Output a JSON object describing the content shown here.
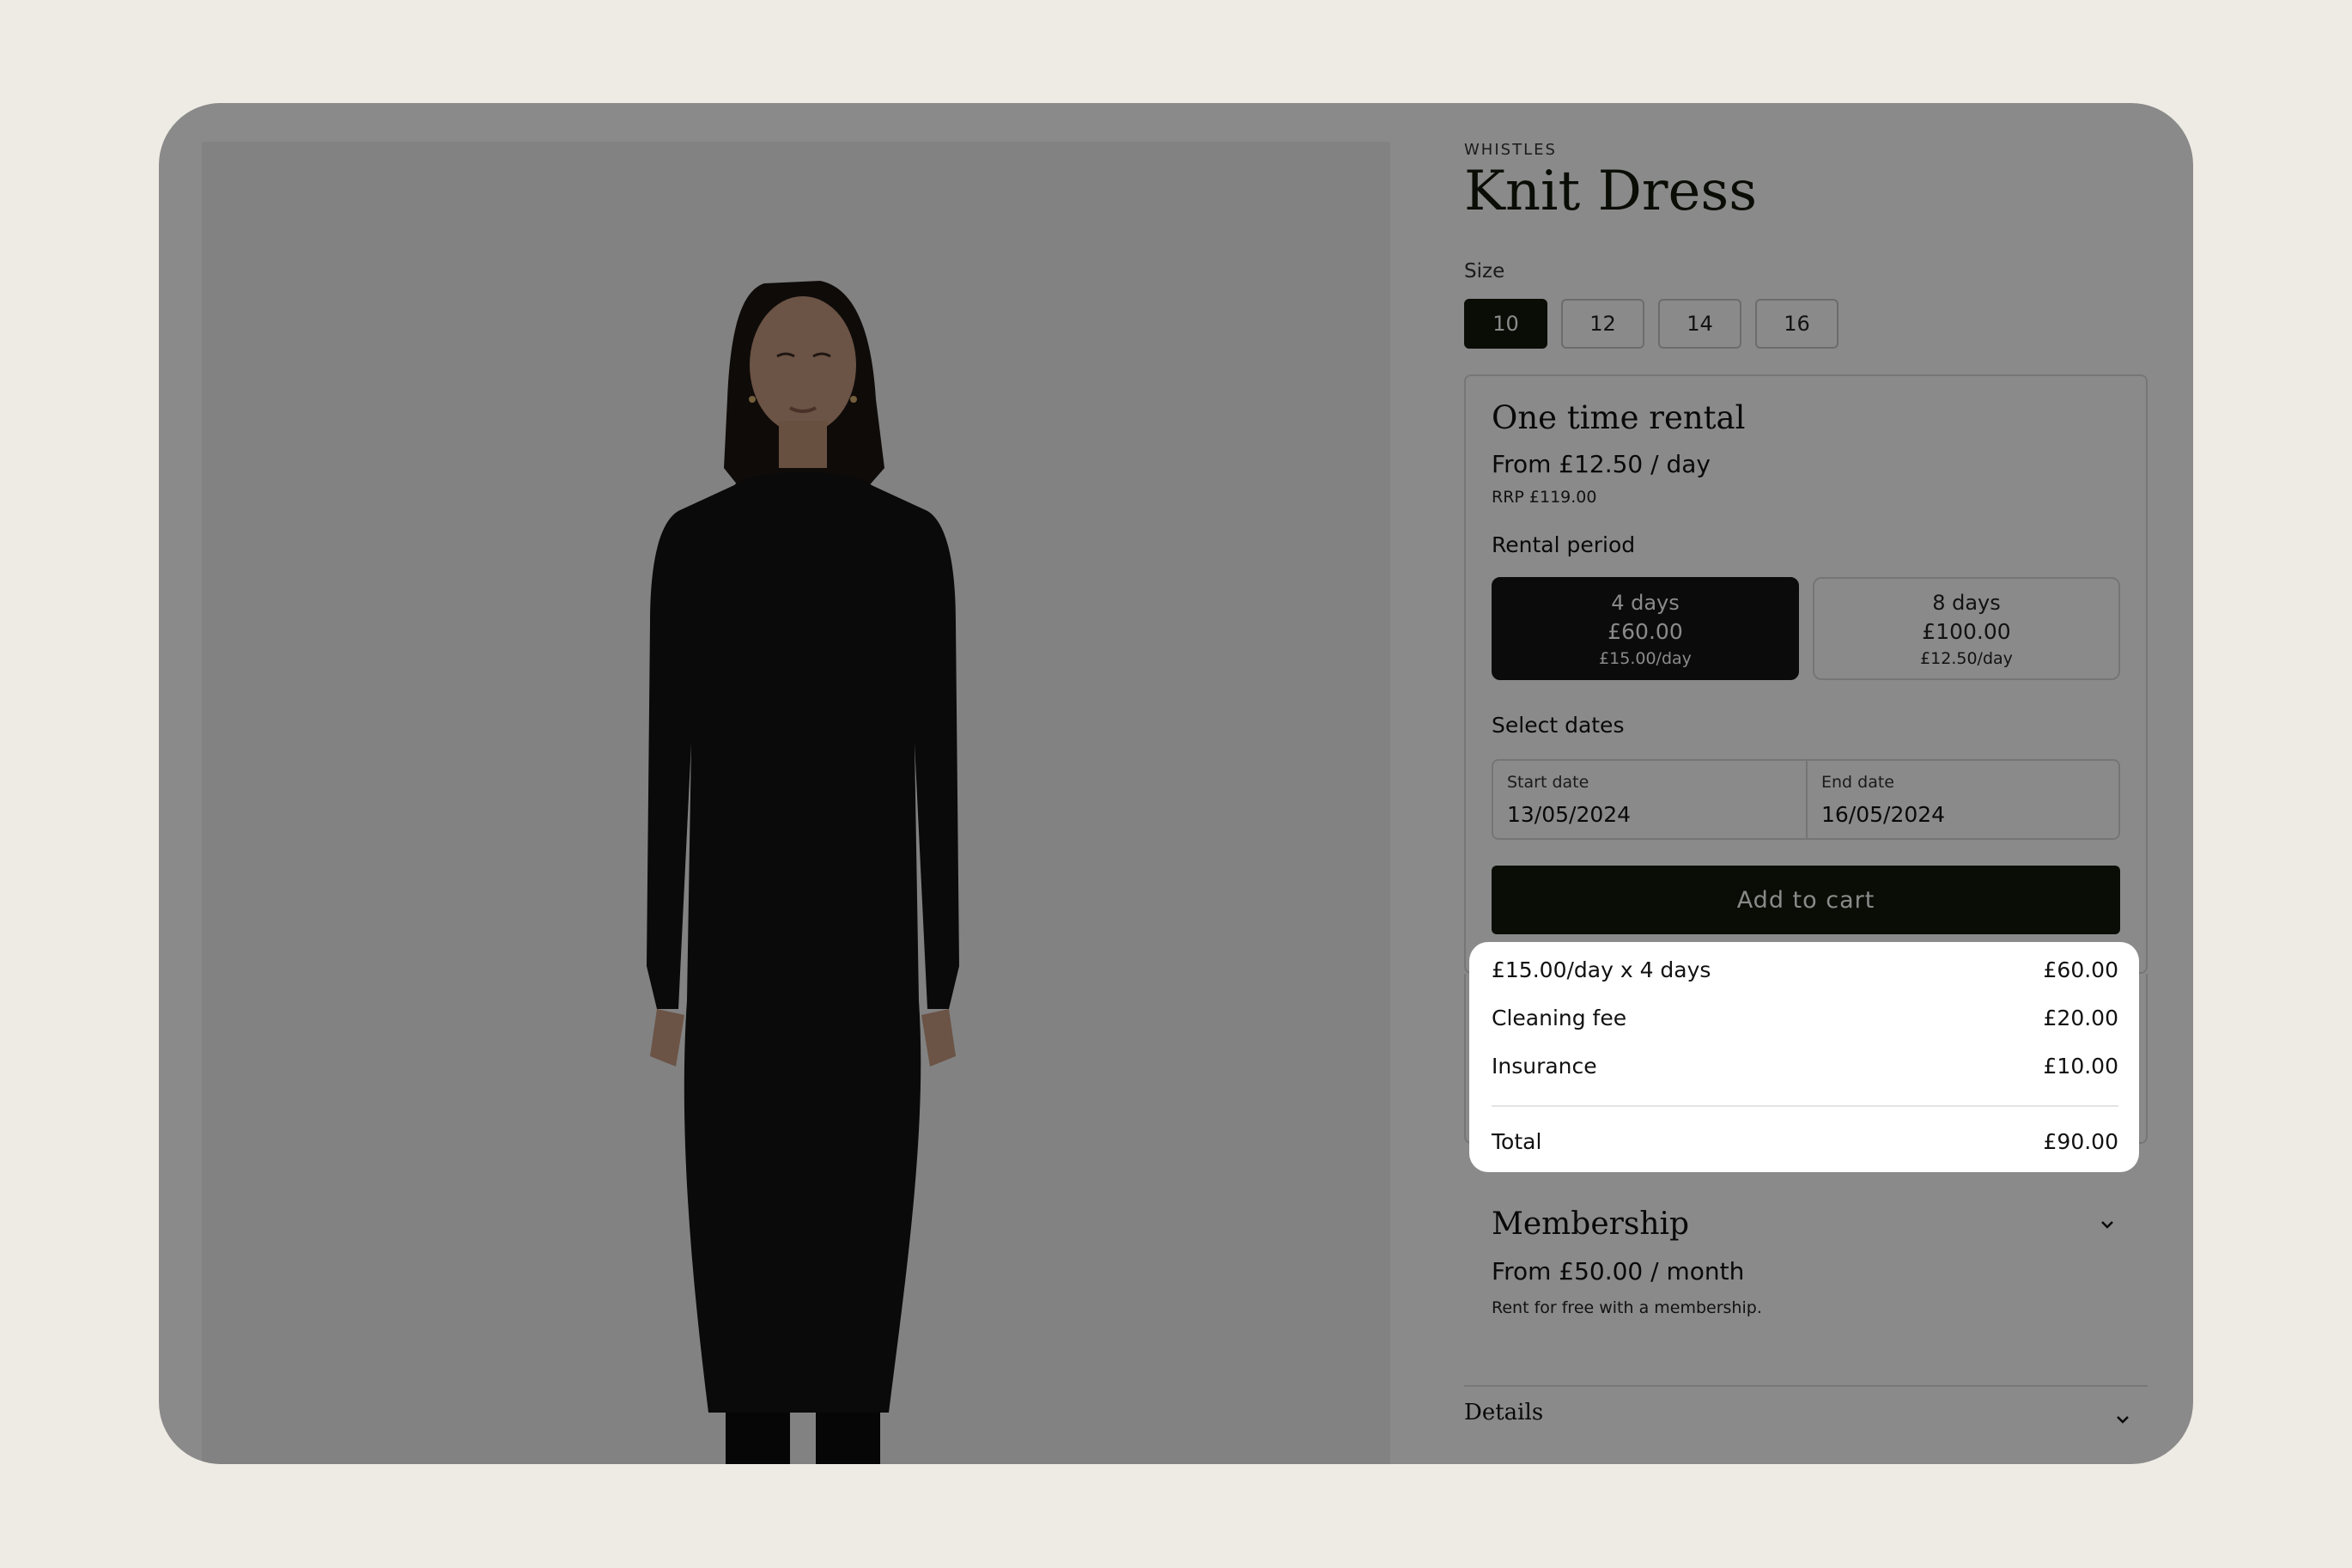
{
  "product": {
    "brand": "WHISTLES",
    "title": "Knit Dress",
    "image_icon": "dress-model-image"
  },
  "size": {
    "label": "Size",
    "options": [
      "10",
      "12",
      "14",
      "16"
    ],
    "selected": "10"
  },
  "rental": {
    "title": "One time rental",
    "price": "From £12.50 / day",
    "rrp": "RRP £119.00",
    "period_label": "Rental period",
    "periods": [
      {
        "days": "4 days",
        "total": "£60.00",
        "per_day": "£15.00/day",
        "selected": true
      },
      {
        "days": "8 days",
        "total": "£100.00",
        "per_day": "£12.50/day",
        "selected": false
      }
    ],
    "dates_label": "Select dates",
    "start": {
      "label": "Start date",
      "value": "13/05/2024"
    },
    "end": {
      "label": "End date",
      "value": "16/05/2024"
    },
    "add_to_cart": "Add to cart"
  },
  "breakdown": {
    "rows": [
      {
        "label": "£15.00/day x 4 days",
        "amount": "£60.00"
      },
      {
        "label": "Cleaning fee",
        "amount": "£20.00"
      },
      {
        "label": "Insurance",
        "amount": "£10.00"
      }
    ],
    "total": {
      "label": "Total",
      "amount": "£90.00"
    }
  },
  "membership": {
    "title": "Membership",
    "price": "From £50.00 / month",
    "note": "Rent for free with a membership.",
    "icon": "chevron-down-icon"
  },
  "details": {
    "title": "Details",
    "icon": "chevron-down-icon"
  },
  "colors": {
    "page_bg": "#eeebe4",
    "accent_dark": "#13180a",
    "overlay": "rgba(0,0,0,0.46)"
  }
}
